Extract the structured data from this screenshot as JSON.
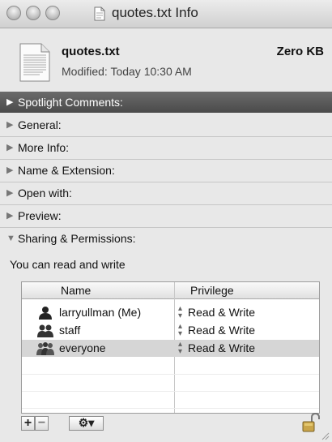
{
  "window": {
    "title": "quotes.txt Info"
  },
  "file": {
    "name": "quotes.txt",
    "modified": "Modified: Today 10:30 AM",
    "size": "Zero KB"
  },
  "sections": {
    "spotlight": "Spotlight Comments:",
    "general": "General:",
    "more_info": "More Info:",
    "name_extension": "Name & Extension:",
    "open_with": "Open with:",
    "preview": "Preview:",
    "sharing": "Sharing & Permissions:"
  },
  "permissions": {
    "summary": "You can read and write",
    "columns": [
      "Name",
      "Privilege"
    ],
    "rows": [
      {
        "name": "larryullman (Me)",
        "privilege": "Read & Write",
        "icon": "single-user-icon"
      },
      {
        "name": "staff",
        "privilege": "Read & Write",
        "icon": "group-icon"
      },
      {
        "name": "everyone",
        "privilege": "Read & Write",
        "icon": "everyone-group-icon"
      }
    ],
    "selected_row": 2
  },
  "toolbar": {
    "add_label": "+",
    "remove_label": "−",
    "action_label": "⚙▾"
  },
  "colors": {
    "spotlight_bar": "#555555",
    "selected_row": "#d6d6d6",
    "window_bg": "#e8e8e8"
  }
}
